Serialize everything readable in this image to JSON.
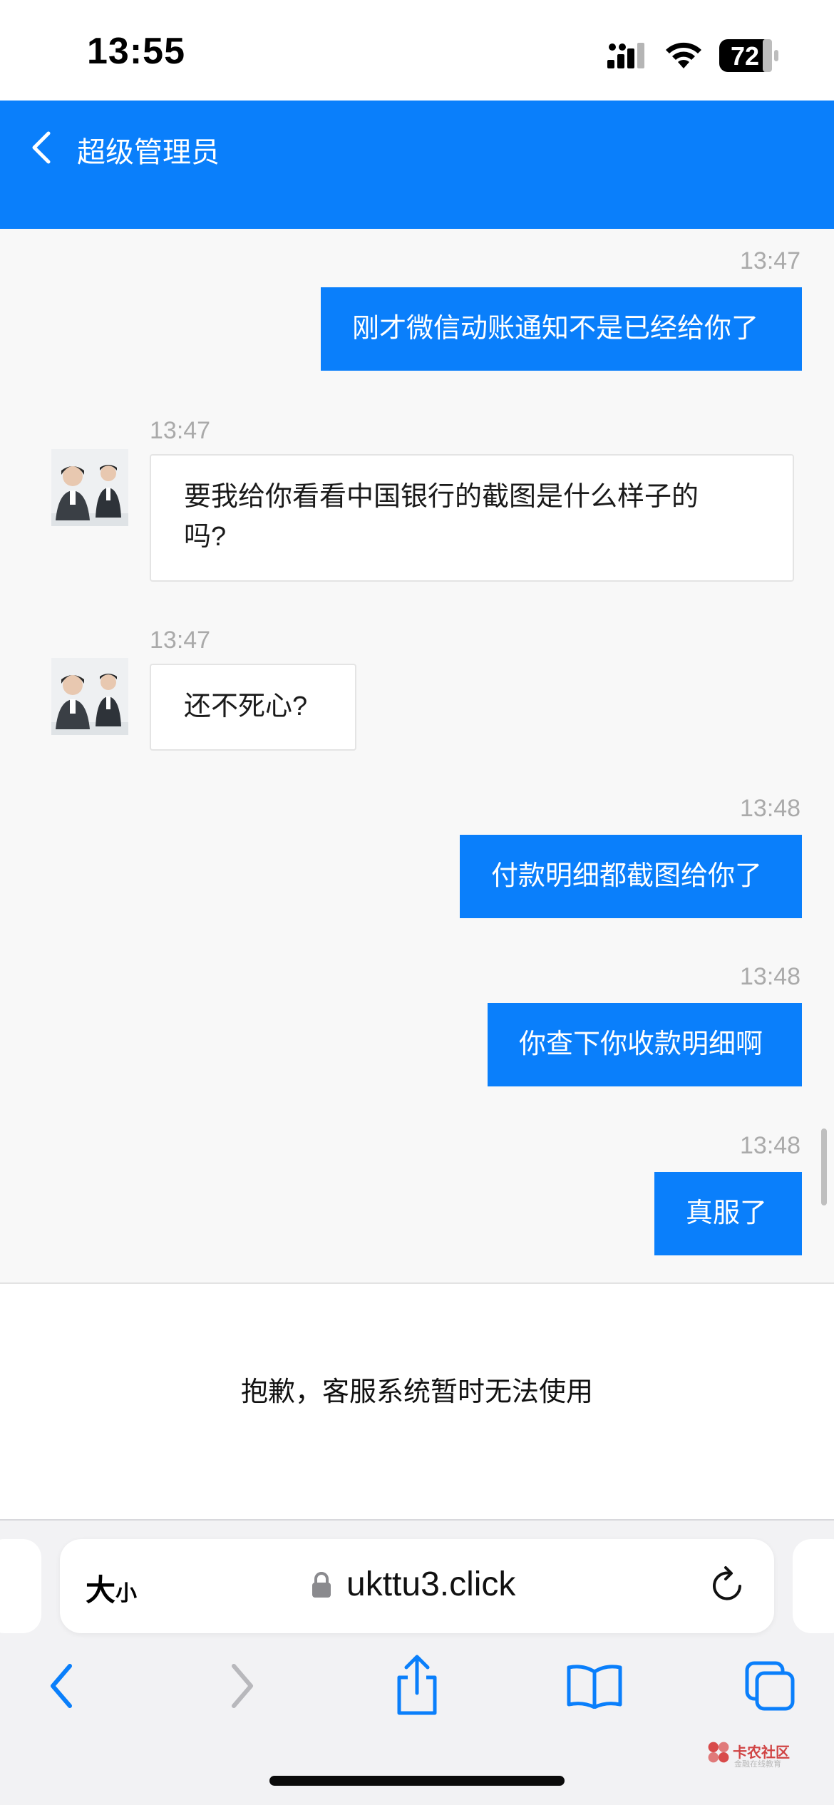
{
  "status_bar": {
    "time": "13:55",
    "battery": "72"
  },
  "header": {
    "title": "超级管理员"
  },
  "messages": [
    {
      "time": "13:47",
      "text": "刚才微信动账通知不是已经给你了"
    },
    {
      "time": "13:47",
      "text_line1": "要我给你看看中国银行的截图是什么样子的",
      "text_line2": "吗?"
    },
    {
      "time": "13:47",
      "text": "还不死心?"
    },
    {
      "time": "13:48",
      "text": "付款明细都截图给你了"
    },
    {
      "time": "13:48",
      "text": "你查下你收款明细啊"
    },
    {
      "time": "13:48",
      "text": "真服了"
    }
  ],
  "notice": {
    "text": "抱歉，客服系统暂时无法使用"
  },
  "browser": {
    "text_size_big": "大",
    "text_size_small": "小",
    "url": "ukttu3.click"
  },
  "watermark": {
    "title": "卡农社区",
    "subtitle": "金融在线教育"
  },
  "colors": {
    "accent": "#0a7ffb",
    "bubble_in": "#ffffff",
    "background": "#f8f8f8"
  }
}
